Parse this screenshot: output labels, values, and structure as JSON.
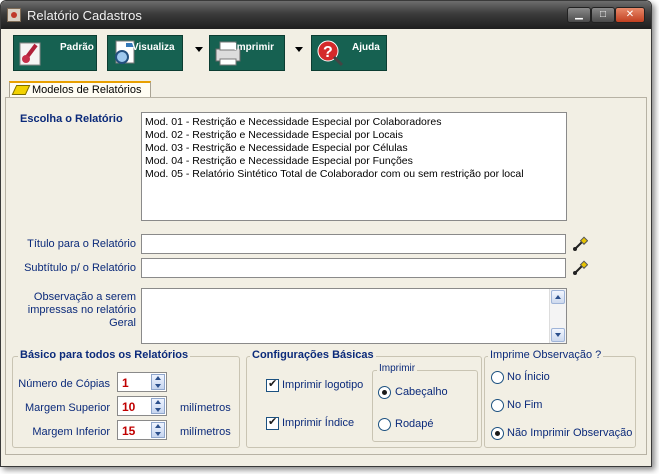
{
  "window": {
    "title": "Relatório Cadastros"
  },
  "toolbar": {
    "padrao": "Padrão",
    "visualiza": "Visualiza",
    "imprimir": "Imprimir",
    "ajuda": "Ajuda"
  },
  "tabs": [
    {
      "label": "Modelos de Relatórios"
    }
  ],
  "form": {
    "choose_label": "Escolha o Relatório",
    "reports": [
      "Mod. 01 - Restrição e Necessidade Especial por Colaboradores",
      "Mod. 02 - Restrição e Necessidade Especial  por Locais",
      "Mod. 03 - Restrição e Necessidade Especial  por Células",
      "Mod. 04 - Restrição e Necessidade Especial  por Funções",
      "Mod. 05 - Relatório Sintético Total de Colaborador com ou sem restrição por local"
    ],
    "title_label": "Título para o Relatório",
    "subtitle_label": "Subtítulo p/ o Relatório",
    "obs_label_1": "Observação a serem",
    "obs_label_2": "impressas no relatório",
    "obs_label_3": "Geral"
  },
  "basic": {
    "title": "Básico para todos os Relatórios",
    "copies_label": "Número de Cópias",
    "copies": "1",
    "top_label": "Margem Superior",
    "top": "10",
    "bottom_label": "Margem Inferior",
    "bottom": "15",
    "unit": "milímetros"
  },
  "config": {
    "title": "Configurações Básicas",
    "logo_label": "Imprimir logotipo",
    "index_label": "Imprimir Índice",
    "print_group": "Imprimir",
    "header": "Cabeçalho",
    "footer": "Rodapé"
  },
  "obs": {
    "title": "Imprime Observação ?",
    "start": "No Ínicio",
    "end": "No Fim",
    "none": "Não Imprimir Observação"
  },
  "colors": {
    "toolbar_button": "#166151",
    "label": "#0b2a7a",
    "value_red": "#c00000",
    "tab_accent": "#e8a000"
  }
}
